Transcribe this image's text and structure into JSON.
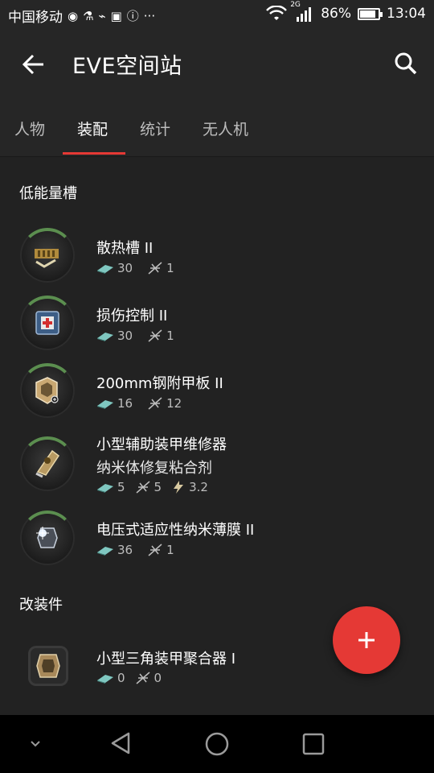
{
  "status_bar": {
    "carrier": "中国移动",
    "network": "2G",
    "battery": "86%",
    "battery_level": 0.86,
    "time": "13:04"
  },
  "toolbar": {
    "title": "EVE空间站"
  },
  "tabs": [
    {
      "label": "人物"
    },
    {
      "label": "装配"
    },
    {
      "label": "统计"
    },
    {
      "label": "无人机"
    }
  ],
  "active_tab": "装配",
  "sections": [
    {
      "title": "低能量槽",
      "items": [
        {
          "name": "散热槽 II",
          "cpu": "30",
          "power": "1"
        },
        {
          "name": "损伤控制 II",
          "cpu": "30",
          "power": "1"
        },
        {
          "name": "200mm钢附甲板 II",
          "cpu": "16",
          "power": "12"
        },
        {
          "name": "小型辅助装甲维修器",
          "sub": "纳米体修复粘合剂",
          "cpu": "5",
          "power": "5",
          "extra": "3.2"
        },
        {
          "name": "电压式适应性纳米薄膜 II",
          "cpu": "36",
          "power": "1"
        }
      ]
    },
    {
      "title": "改装件",
      "items": [
        {
          "name": "小型三角装甲聚合器 I",
          "cpu": "0",
          "power": "0"
        }
      ]
    }
  ],
  "colors": {
    "accent": "#e53935",
    "background": "#222222",
    "bar": "#262626",
    "ring": "#5b8e4f"
  },
  "icons": {
    "back": "arrow-left-icon",
    "search": "search-icon",
    "fab": "plus-icon",
    "cpu": "cpu-chip-icon",
    "power": "powergrid-icon",
    "capacitor": "bolt-icon"
  }
}
